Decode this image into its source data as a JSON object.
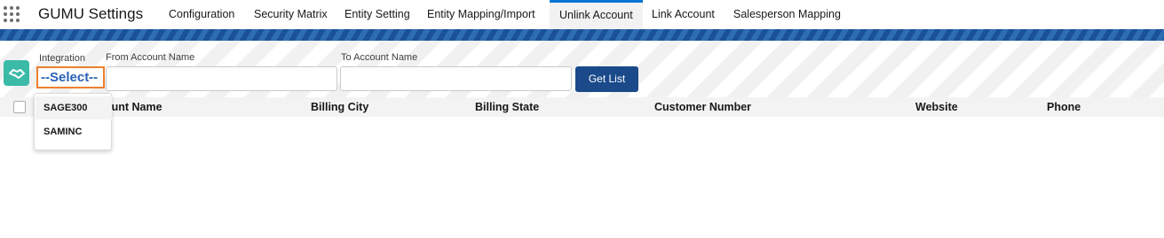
{
  "header": {
    "app_name": "GUMU Settings",
    "tabs": [
      {
        "label": "Configuration"
      },
      {
        "label": "Security Matrix"
      },
      {
        "label": "Entity Setting"
      },
      {
        "label": "Entity Mapping/Import"
      },
      {
        "label": "Unlink Account",
        "active": true
      },
      {
        "label": "Link Account"
      },
      {
        "label": "Salesperson Mapping"
      }
    ]
  },
  "filter": {
    "integration_label": "Integration",
    "integration_value": "--Select--",
    "from_label": "From Account Name",
    "from_value": "",
    "to_label": "To Account Name",
    "to_value": "",
    "get_list_label": "Get List"
  },
  "table": {
    "columns": [
      "Account Name",
      "Billing City",
      "Billing State",
      "Customer Number",
      "Website",
      "Phone"
    ]
  },
  "dropdown": {
    "options": [
      "SAGE300",
      "SAMINC"
    ],
    "highlighted_index": 0
  },
  "colors": {
    "accent": "#0176d3",
    "band": "#1b5297",
    "button": "#1b4a8a",
    "select_border": "#ee7f2d",
    "select_text": "#2a62b7",
    "brand_icon": "#3bbaa8"
  }
}
